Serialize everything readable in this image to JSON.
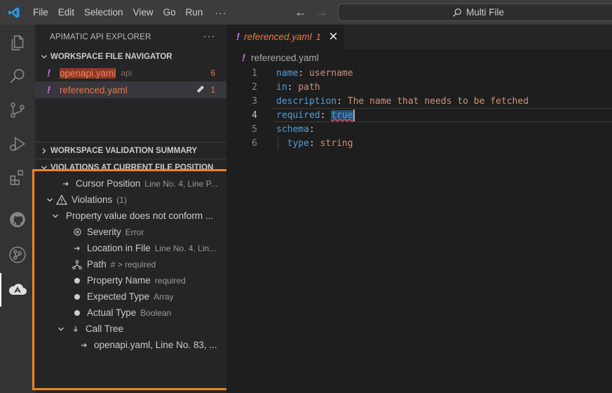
{
  "menu": [
    "File",
    "Edit",
    "Selection",
    "View",
    "Go",
    "Run"
  ],
  "menu_more": "···",
  "command_center": "Multi File",
  "sidebar": {
    "title": "APIMATIC API EXPLORER",
    "more": "···",
    "navigator": {
      "header": "WORKSPACE FILE NAVIGATOR",
      "files": [
        {
          "mark": "!",
          "name": "openapi.yaml",
          "desc": "api",
          "count": "6"
        },
        {
          "mark": "!",
          "name": "referenced.yaml",
          "count": "1"
        }
      ]
    },
    "summary_header": "WORKSPACE VALIDATION SUMMARY",
    "violations_panel": {
      "header": "VIOLATIONS AT CURRENT FILE POSITION",
      "cursor": {
        "label": "Cursor Position",
        "value": "Line No. 4, Line P..."
      },
      "violations": {
        "label": "Violations",
        "count": "(1)"
      },
      "violation_title": "Property value does not conform ...",
      "details": [
        {
          "label": "Severity",
          "value": "Error",
          "icon": "error-circle-icon"
        },
        {
          "label": "Location in File",
          "value": "Line No. 4, Lin...",
          "icon": "arrow-right-icon"
        },
        {
          "label": "Path",
          "value": "# > required",
          "icon": "path-tree-icon"
        },
        {
          "label": "Property Name",
          "value": "required",
          "icon": "dot-icon"
        },
        {
          "label": "Expected Type",
          "value": "Array",
          "icon": "dot-icon"
        },
        {
          "label": "Actual Type",
          "value": "Boolean",
          "icon": "dot-icon"
        }
      ],
      "call_tree": {
        "label": "Call Tree",
        "entry": "openapi.yaml, Line No. 83, ..."
      }
    }
  },
  "editor": {
    "tab": {
      "mark": "!",
      "name": "referenced.yaml",
      "count": "1"
    },
    "breadcrumb": {
      "mark": "!",
      "name": "referenced.yaml"
    },
    "lines": [
      {
        "num": "1",
        "key": "name",
        "sep": ": ",
        "val": "username"
      },
      {
        "num": "2",
        "key": "in",
        "sep": ": ",
        "val": "path"
      },
      {
        "num": "3",
        "key": "description",
        "sep": ": ",
        "val": "The name that needs to be fetched"
      },
      {
        "num": "4",
        "key": "required",
        "sep": ": ",
        "val": "true"
      },
      {
        "num": "5",
        "key": "schema",
        "sep": ":",
        "val": ""
      },
      {
        "num": "6",
        "key": "type",
        "sep": ": ",
        "val": "string"
      }
    ]
  },
  "colors": {
    "accent_highlight": "#f58220",
    "warning": "#e8764b",
    "keyword": "#569cd6",
    "string": "#ce9178"
  }
}
